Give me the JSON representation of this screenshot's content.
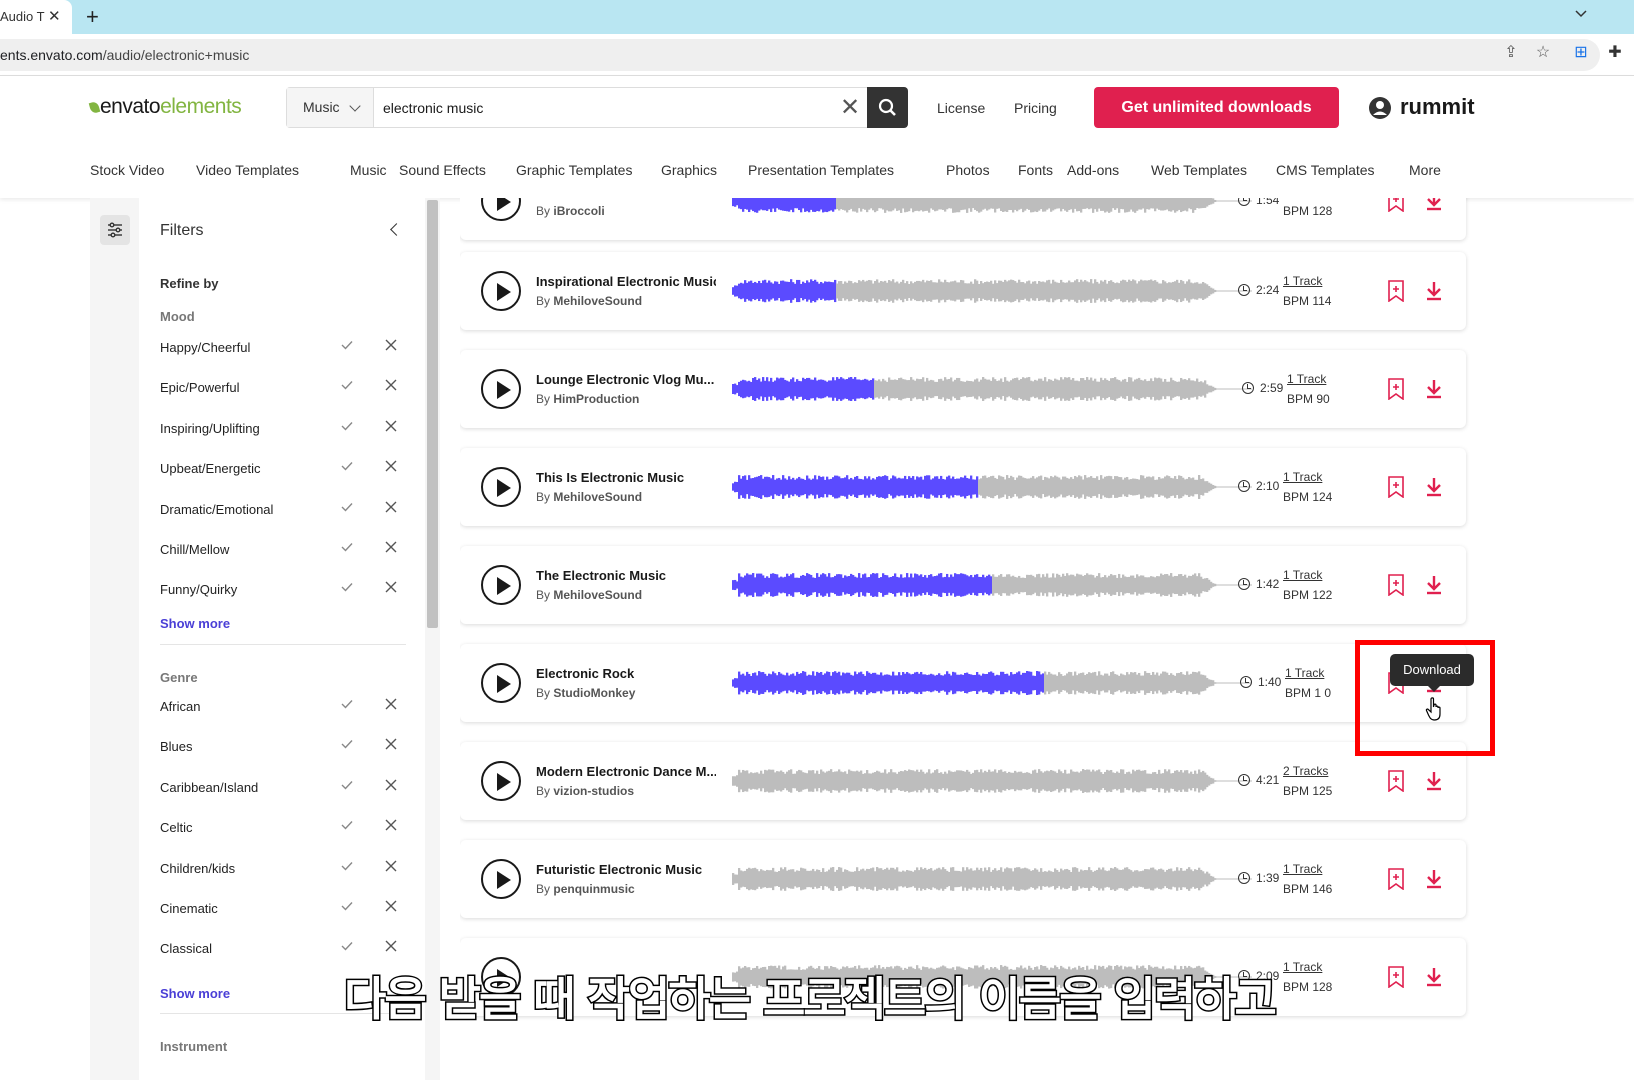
{
  "browser": {
    "tab_title": "Audio T",
    "new_tab": "+",
    "url_domain": "ents.envato.com",
    "url_path": "/audio/electronic+music"
  },
  "header": {
    "logo_part1": "envato",
    "logo_part2": "elements",
    "search_category": "Music",
    "search_value": "electronic music",
    "license": "License",
    "pricing": "Pricing",
    "cta": "Get unlimited downloads",
    "username": "rummit"
  },
  "nav": [
    "Stock Video",
    "Video Templates",
    "Music",
    "Sound Effects",
    "Graphic Templates",
    "Graphics",
    "Presentation Templates",
    "Photos",
    "Fonts",
    "Add-ons",
    "Web Templates",
    "CMS Templates",
    "More"
  ],
  "filters": {
    "title": "Filters",
    "refine_by": "Refine by",
    "mood_label": "Mood",
    "mood": [
      "Happy/Cheerful",
      "Epic/Powerful",
      "Inspiring/Uplifting",
      "Upbeat/Energetic",
      "Dramatic/Emotional",
      "Chill/Mellow",
      "Funny/Quirky"
    ],
    "show_more": "Show more",
    "genre_label": "Genre",
    "genre": [
      "African",
      "Blues",
      "Caribbean/Island",
      "Celtic",
      "Children/kids",
      "Cinematic",
      "Classical"
    ],
    "instrument_label": "Instrument"
  },
  "tracks": [
    {
      "title": "",
      "author": "iBroccoli",
      "by": "By",
      "duration": "1:54",
      "tracks": "",
      "bpm": "BPM 128",
      "progress": 0.2
    },
    {
      "title": "Inspirational Electronic Music",
      "author": "MehiloveSound",
      "by": "By",
      "duration": "2:24",
      "tracks": "1 Track",
      "bpm": "BPM 114",
      "progress": 0.2
    },
    {
      "title": "Lounge Electronic Vlog Mu...",
      "author": "HimProduction",
      "by": "By",
      "duration": "2:59",
      "tracks": "1 Track",
      "bpm": "BPM 90",
      "progress": 0.27
    },
    {
      "title": "This Is Electronic Music",
      "author": "MehiloveSound",
      "by": "By",
      "duration": "2:10",
      "tracks": "1 Track",
      "bpm": "BPM 124",
      "progress": 0.47
    },
    {
      "title": "The Electronic Music",
      "author": "MehiloveSound",
      "by": "By",
      "duration": "1:42",
      "tracks": "1 Track",
      "bpm": "BPM 122",
      "progress": 0.5
    },
    {
      "title": "Electronic Rock",
      "author": "StudioMonkey",
      "by": "By",
      "duration": "1:40",
      "tracks": "1 Track",
      "bpm": "BPM 1 0",
      "progress": 0.6
    },
    {
      "title": "Modern Electronic Dance M...",
      "author": "vizion-studios",
      "by": "By",
      "duration": "4:21",
      "tracks": "2 Tracks",
      "bpm": "BPM 125",
      "progress": 0
    },
    {
      "title": "Futuristic Electronic Music",
      "author": "penquinmusic",
      "by": "By",
      "duration": "1:39",
      "tracks": "1 Track",
      "bpm": "BPM 146",
      "progress": 0
    },
    {
      "title": "",
      "author": "",
      "by": "",
      "duration": "2:09",
      "tracks": "1 Track",
      "bpm": "BPM 128",
      "progress": 0
    }
  ],
  "tooltip": "Download",
  "subtitle": "다음 받을 때 작업하는 프로젝트의 이름을 입력하고",
  "colors": {
    "accent": "#e0204f",
    "wave_played": "#5b4bff",
    "wave_unplayed": "#bdbdbd",
    "brand_green": "#82b541",
    "link": "#4a3fd6"
  }
}
